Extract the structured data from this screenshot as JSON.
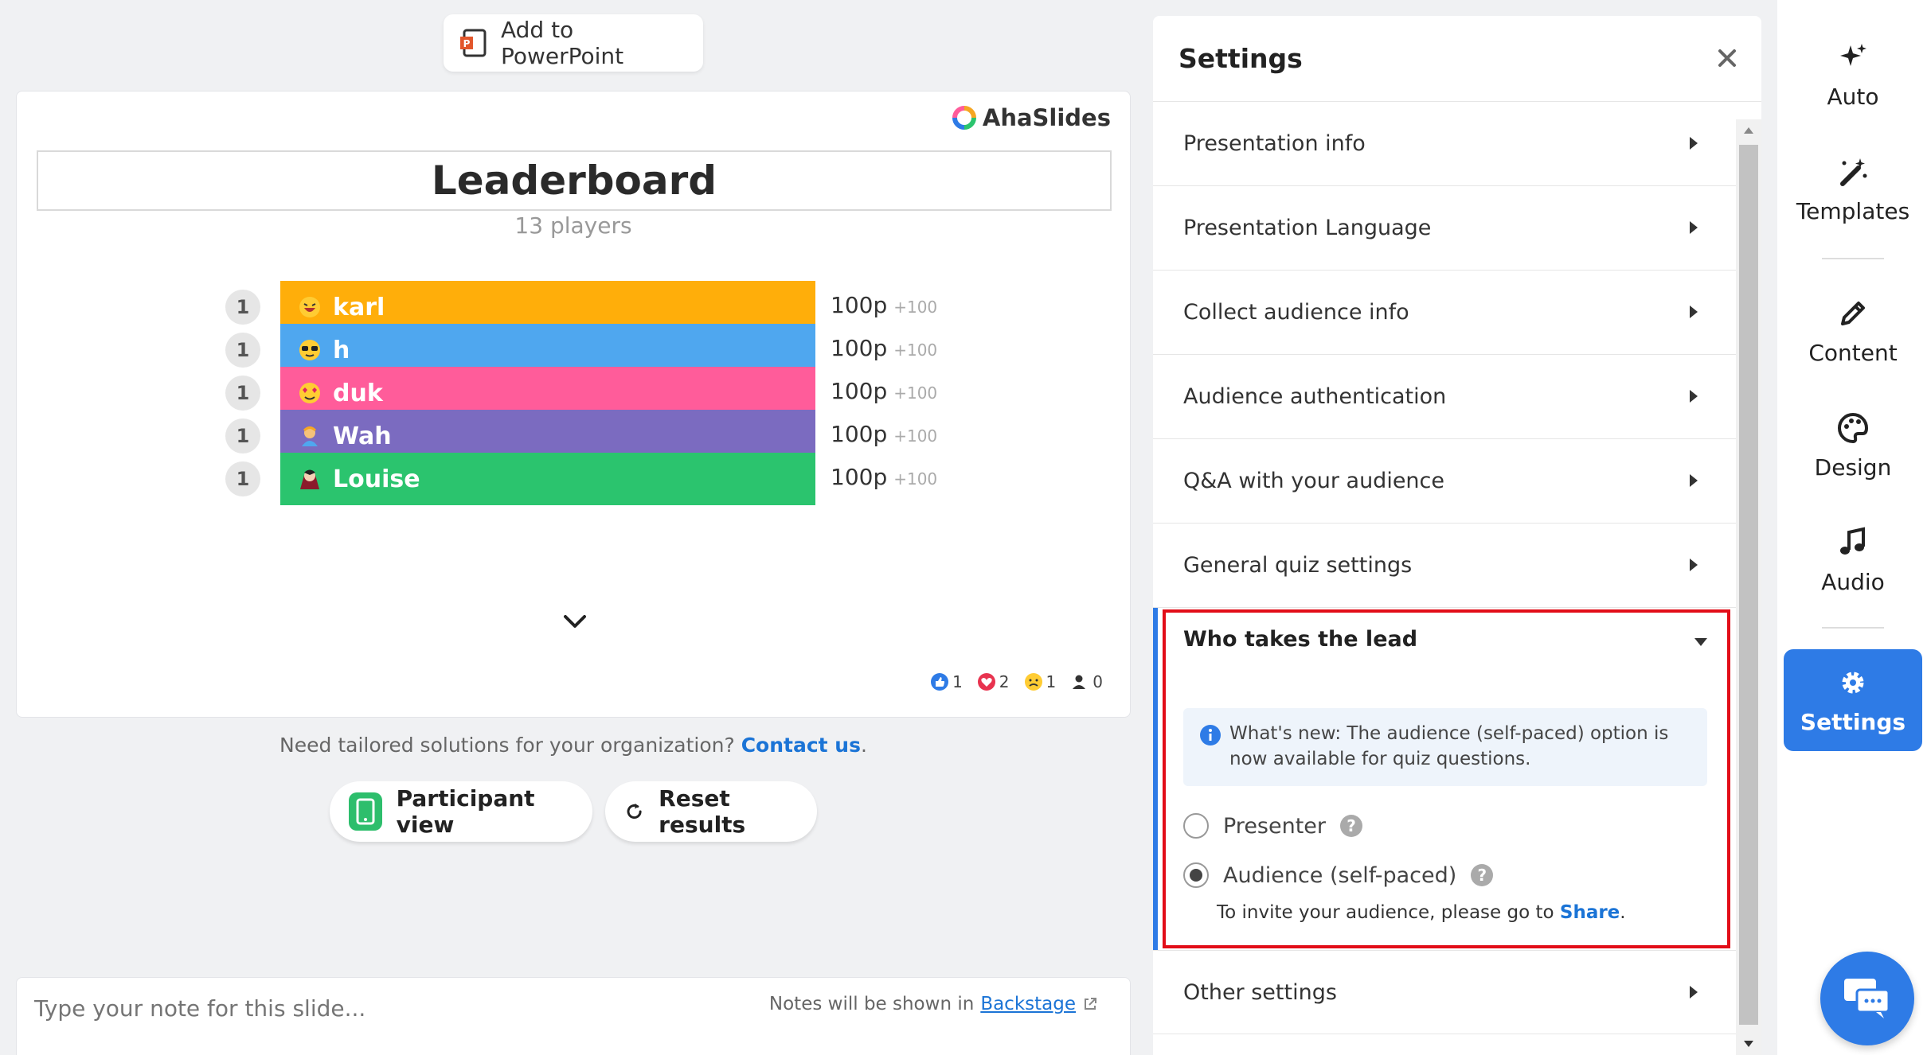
{
  "toolbar": {
    "add_to_ppt_label": "Add to PowerPoint"
  },
  "slide": {
    "brand": "AhaSlides",
    "title": "Leaderboard",
    "players_count": "13 players",
    "rows": [
      {
        "rank": "1",
        "name": "karl",
        "score": "100p",
        "delta": "+100",
        "color": "#FFAE0A"
      },
      {
        "rank": "1",
        "name": "h",
        "score": "100p",
        "delta": "+100",
        "color": "#4FA7EF"
      },
      {
        "rank": "1",
        "name": "duk",
        "score": "100p",
        "delta": "+100",
        "color": "#FF5C9A"
      },
      {
        "rank": "1",
        "name": "Wah",
        "score": "100p",
        "delta": "+100",
        "color": "#7B6BC0"
      },
      {
        "rank": "1",
        "name": "Louise",
        "score": "100p",
        "delta": "+100",
        "color": "#2BC46E"
      }
    ],
    "reactions": {
      "like": "1",
      "heart": "2",
      "sad": "1",
      "participants": "0"
    }
  },
  "cta": {
    "text": "Need tailored solutions for your organization? ",
    "link": "Contact us",
    "period": "."
  },
  "actions": {
    "participant_view": "Participant view",
    "reset_results": "Reset results"
  },
  "notes": {
    "placeholder": "Type your note for this slide...",
    "hint_prefix": "Notes will be shown in ",
    "hint_link": "Backstage"
  },
  "settings": {
    "title": "Settings",
    "items": [
      "Presentation info",
      "Presentation Language",
      "Collect audience info",
      "Audience authentication",
      "Q&A with your audience",
      "General quiz settings"
    ],
    "lead": {
      "title": "Who takes the lead",
      "info": "What's new: The audience (self-paced) option is now available for quiz questions.",
      "option_presenter": "Presenter",
      "option_audience": "Audience (self-paced)",
      "selected": "Audience (self-paced)",
      "invite_prefix": "To invite your audience, please go to ",
      "invite_link": "Share",
      "invite_suffix": "."
    },
    "other": "Other settings"
  },
  "rail": {
    "auto": "Auto",
    "templates": "Templates",
    "content": "Content",
    "design": "Design",
    "audio": "Audio",
    "settings": "Settings"
  },
  "colors": {
    "accent": "#2E7BE6",
    "highlight": "#E20D18",
    "link": "#1B74D6"
  }
}
